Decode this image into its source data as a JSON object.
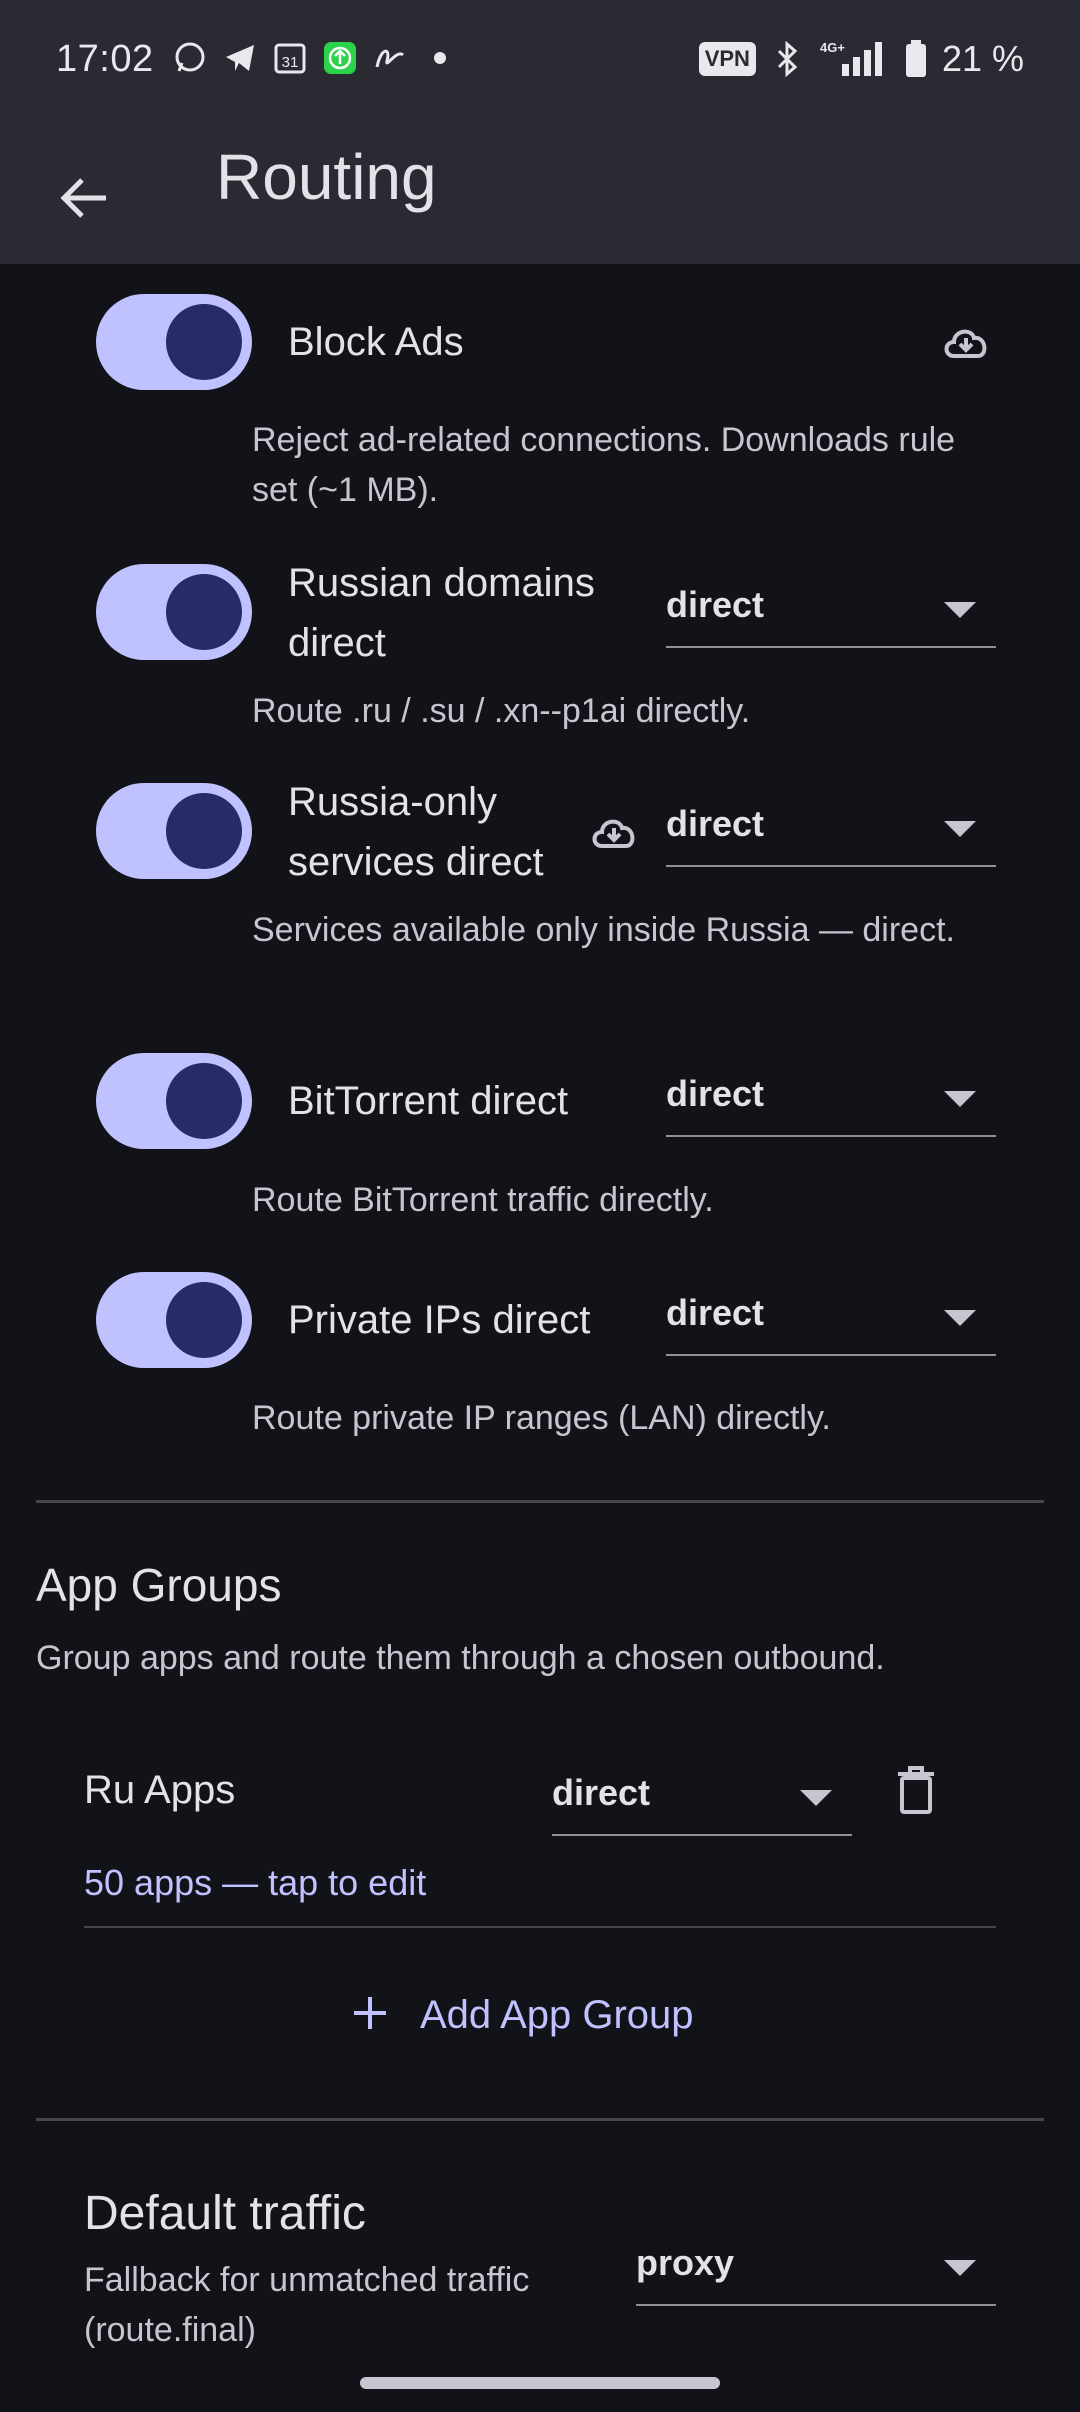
{
  "status_bar": {
    "time": "17:02",
    "vpn": "VPN",
    "network": "4G+",
    "battery": "21 %",
    "left_icons": [
      "whatsapp-icon",
      "telegram-icon",
      "calendar-icon",
      "upload-app-icon",
      "swipe-app-icon",
      "dot-icon"
    ],
    "calendar_day": "31"
  },
  "app_bar": {
    "title": "Routing"
  },
  "rules": [
    {
      "label": "Block Ads",
      "desc": "Reject ad-related connections. Downloads rule set (~1 MB).",
      "enabled": true,
      "has_download": true
    },
    {
      "label": "Russian domains direct",
      "desc": "Route .ru / .su / .xn--p1ai directly.",
      "enabled": true,
      "outbound": "direct"
    },
    {
      "label": "Russia-only services direct",
      "desc": "Services available only inside Russia — direct.",
      "enabled": true,
      "outbound": "direct",
      "has_download": true
    },
    {
      "label": "BitTorrent direct",
      "desc": "Route BitTorrent traffic directly.",
      "enabled": true,
      "outbound": "direct"
    },
    {
      "label": "Private IPs direct",
      "desc": "Route private IP ranges (LAN) directly.",
      "enabled": true,
      "outbound": "direct"
    }
  ],
  "app_groups": {
    "title": "App Groups",
    "desc": "Group apps and route them through a chosen outbound.",
    "groups": [
      {
        "name": "Ru Apps",
        "outbound": "direct",
        "summary": "50 apps — tap to edit"
      }
    ],
    "add_label": "Add App Group"
  },
  "default_traffic": {
    "title": "Default traffic",
    "desc": "Fallback for unmatched traffic (route.final)",
    "outbound": "proxy"
  },
  "colors": {
    "background": "#121318",
    "surface": "#292a32",
    "accent": "#bfc2ff",
    "switch_thumb": "#262c68"
  }
}
